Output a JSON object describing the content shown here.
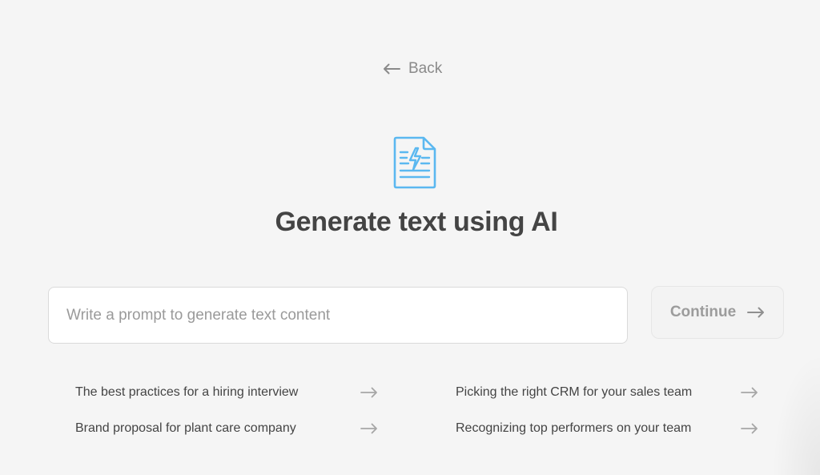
{
  "nav": {
    "back_label": "Back",
    "back_icon": "arrow-left-icon"
  },
  "header": {
    "icon": "ai-document-icon",
    "icon_color": "#5bb8f0",
    "title": "Generate text using AI"
  },
  "prompt": {
    "placeholder": "Write a prompt to generate text content",
    "value": ""
  },
  "continue_button": {
    "label": "Continue",
    "icon": "arrow-right-icon"
  },
  "suggestions": [
    {
      "label": "The best practices for a hiring interview",
      "icon": "arrow-right-icon"
    },
    {
      "label": "Brand proposal for plant care company",
      "icon": "arrow-right-icon"
    },
    {
      "label": "Picking the right CRM for your sales team",
      "icon": "arrow-right-icon"
    },
    {
      "label": "Recognizing top performers on your team",
      "icon": "arrow-right-icon"
    }
  ]
}
